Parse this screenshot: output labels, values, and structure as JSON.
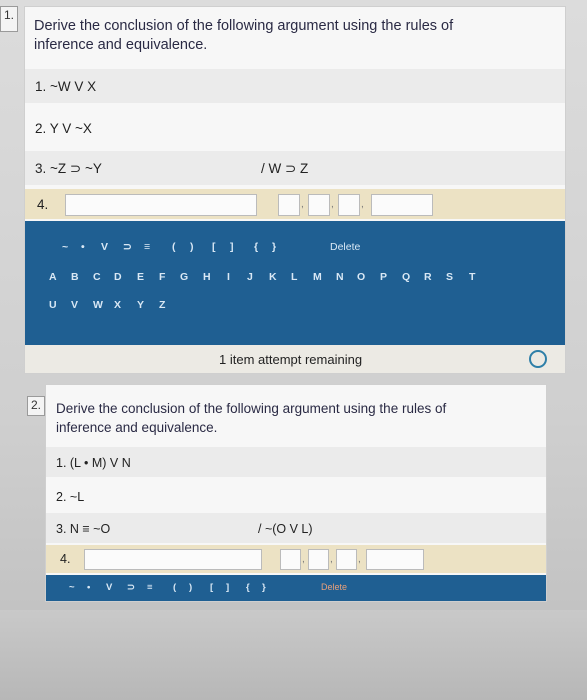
{
  "q1": {
    "number": "1.",
    "prompt_line1": "Derive the conclusion of the following argument using the rules of",
    "prompt_line2": "inference and equivalence.",
    "premises": [
      "1.  ~W V X",
      "2.  Y V ~X",
      "3.  ~Z ⊃ ~Y"
    ],
    "conclusion": "/ W ⊃ Z",
    "line4_label": "4.",
    "symbols": [
      "~",
      "•",
      "V",
      "⊃",
      "≡",
      "(",
      ")",
      "[",
      "]",
      "{",
      "}"
    ],
    "delete_label": "Delete",
    "letters_row1": [
      "A",
      "B",
      "C",
      "D",
      "E",
      "F",
      "G",
      "H",
      "I",
      "J",
      "K",
      "L",
      "M",
      "N",
      "O",
      "P",
      "Q",
      "R",
      "S",
      "T"
    ],
    "letters_row2": [
      "U",
      "V",
      "W",
      "X",
      "Y",
      "Z"
    ],
    "attempts": "1 item attempt remaining"
  },
  "q2": {
    "number": "2.",
    "prompt_line1": "Derive the conclusion of the following argument using the rules of",
    "prompt_line2": "inference and equivalence.",
    "premises": [
      "1.  (L • M) V N",
      "2.  ~L",
      "3.  N ≡ ~O"
    ],
    "conclusion": "/ ~(O V L)",
    "line4_label": "4.",
    "symbols": [
      "~",
      "•",
      "V",
      "⊃",
      "≡",
      "(",
      ")",
      "[",
      "]",
      "{",
      "}"
    ],
    "delete_label": "Delete"
  }
}
